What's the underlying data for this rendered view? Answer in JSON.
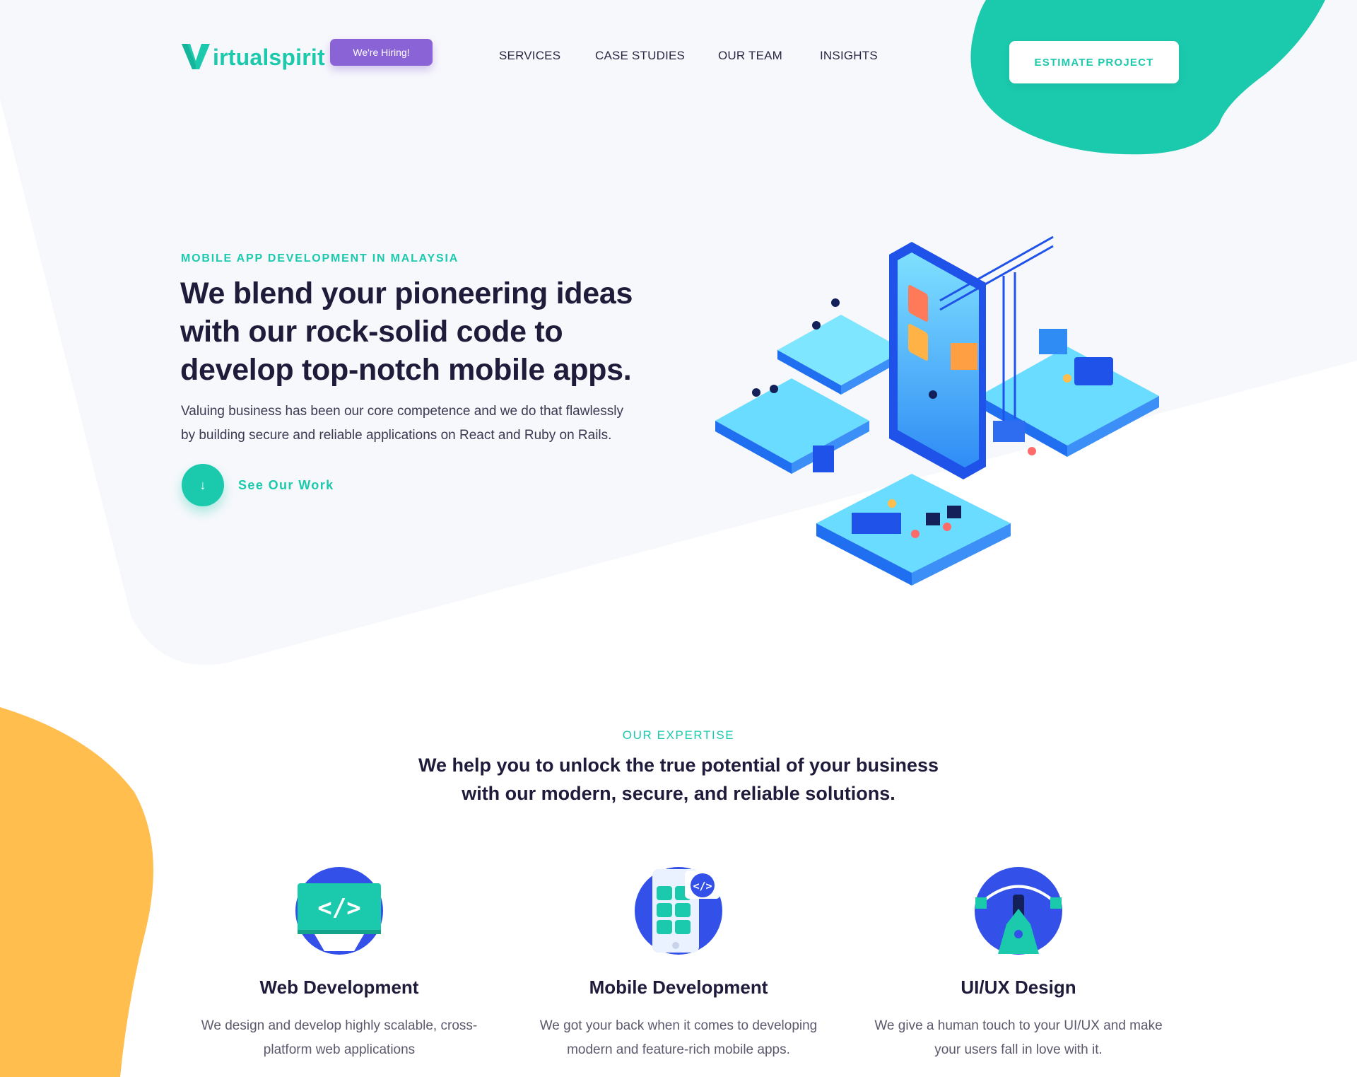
{
  "brand": {
    "name": "Virtualspirit",
    "logo_letter": "V",
    "logo_rest": "irtualspirit",
    "accent": "#1bc9ad",
    "purple": "#8a64d7",
    "yellow": "#ffbe4d",
    "blue": "#3350e8"
  },
  "header": {
    "hiring_label": "We're Hiring!",
    "nav": [
      "SERVICES",
      "CASE STUDIES",
      "OUR TEAM",
      "INSIGHTS"
    ],
    "cta_label": "ESTIMATE PROJECT"
  },
  "hero": {
    "eyebrow": "MOBILE APP DEVELOPMENT IN MALAYSIA",
    "title_lines": [
      "We blend your pioneering ideas",
      "with our rock-solid code to",
      "develop top-notch mobile apps."
    ],
    "description_lines": [
      "Valuing business has been our core competence and we do that flawlessly",
      "by building secure and reliable applications on React and Ruby on Rails."
    ],
    "see_work_label": "See Our Work",
    "see_work_icon": "arrow-down-icon",
    "illustration": "isometric-mobile-app-construction-illustration"
  },
  "expertise": {
    "eyebrow": "OUR EXPERTISE",
    "title_lines": [
      "We help you to unlock the true potential of your business",
      "with our modern, secure, and reliable solutions."
    ],
    "cards": [
      {
        "title": "Web Development",
        "desc_lines": [
          "We design and develop highly scalable, cross-",
          "platform web applications"
        ],
        "icon": "code-window-icon"
      },
      {
        "title": "Mobile Development",
        "desc_lines": [
          "We got your back when it comes to developing",
          "modern and feature-rich mobile apps."
        ],
        "icon": "mobile-app-code-icon"
      },
      {
        "title": "UI/UX Design",
        "desc_lines": [
          "We give a human touch to your UI/UX and make",
          "your users fall in love with it."
        ],
        "icon": "pen-tool-icon"
      }
    ]
  }
}
